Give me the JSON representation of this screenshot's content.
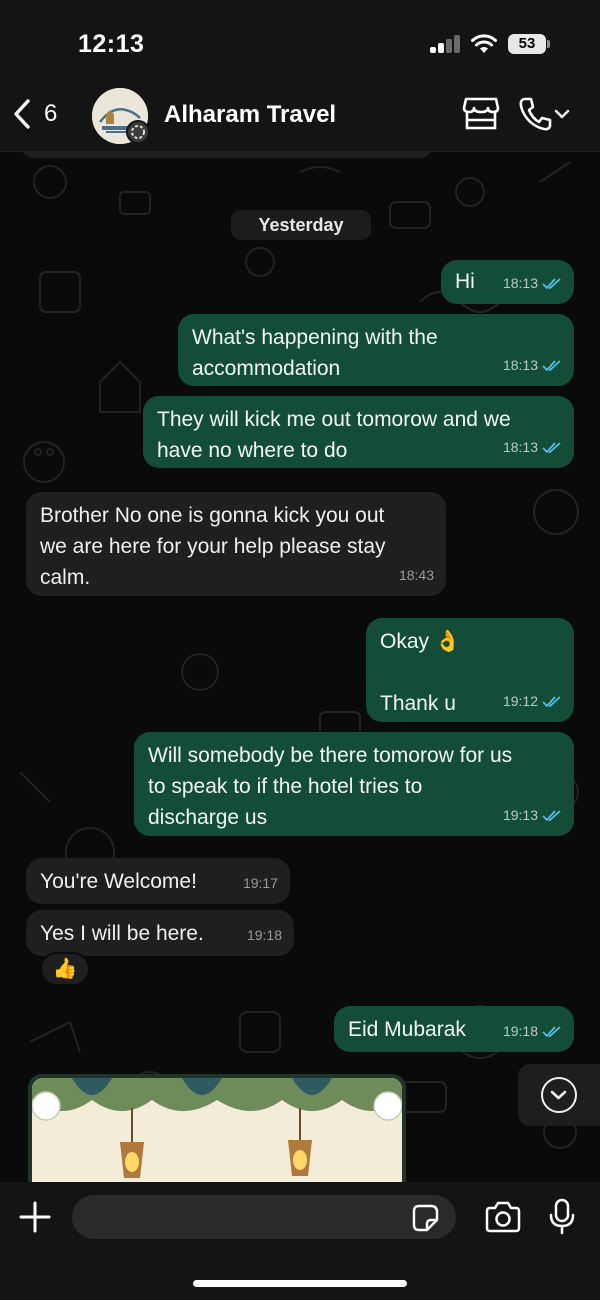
{
  "status_bar": {
    "time": "12:13",
    "battery": "53"
  },
  "header": {
    "back_count": "6",
    "contact_name": "Alharam Travel"
  },
  "chat": {
    "date_label": "Yesterday",
    "messages": [
      {
        "direction": "out",
        "text": "Hi",
        "time": "18:13",
        "read": true
      },
      {
        "direction": "out",
        "text": "What's happening with the\naccommodation",
        "time": "18:13",
        "read": true
      },
      {
        "direction": "out",
        "text": "They will kick me out tomorow and we\nhave no where to do",
        "time": "18:13",
        "read": true
      },
      {
        "direction": "in",
        "text": "Brother No one is gonna kick you out\nwe are here for your help please stay\ncalm.",
        "time": "18:43"
      },
      {
        "direction": "out",
        "text": "Okay 👌\n\nThank u",
        "time": "19:12",
        "read": true
      },
      {
        "direction": "out",
        "text": "Will somebody be there tomorow for us\nto speak to if the hotel tries to\ndischarge us",
        "time": "19:13",
        "read": true
      },
      {
        "direction": "in",
        "text": "You're Welcome!",
        "time": "19:17"
      },
      {
        "direction": "in",
        "text": "Yes I will be here.",
        "time": "19:18",
        "reaction": "👍"
      },
      {
        "direction": "out",
        "text": "Eid Mubarak",
        "time": "19:18",
        "read": true
      }
    ]
  },
  "colors": {
    "outgoing_bubble": "#144d37",
    "incoming_bubble": "#1f1f1f",
    "read_tick": "#53bdeb",
    "background": "#0a0a0a"
  },
  "icons": {
    "back": "chevron-left-icon",
    "store": "storefront-icon",
    "call": "phone-icon",
    "attach": "plus-icon",
    "sticker": "sticker-icon",
    "camera": "camera-icon",
    "mic": "microphone-icon",
    "scroll": "chevron-down-circle-icon"
  }
}
